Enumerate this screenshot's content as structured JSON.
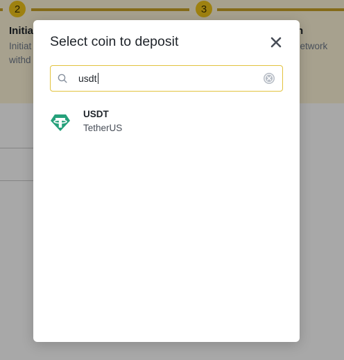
{
  "background": {
    "steps": [
      {
        "number": "2",
        "heading": "Initia",
        "desc_lines": [
          "Initiat",
          "withd"
        ]
      },
      {
        "number": "3",
        "heading": "n",
        "desc_lines": [
          "network"
        ]
      }
    ]
  },
  "modal": {
    "title": "Select coin to deposit",
    "close_icon": "close-icon",
    "search": {
      "value": "usdt",
      "search_icon": "search-icon",
      "clear_icon": "clear-circle-icon",
      "border_color": "#e2c23d"
    },
    "results": [
      {
        "symbol": "USDT",
        "name": "TetherUS",
        "icon": "tether-icon",
        "icon_color": "#26a17b"
      }
    ]
  }
}
